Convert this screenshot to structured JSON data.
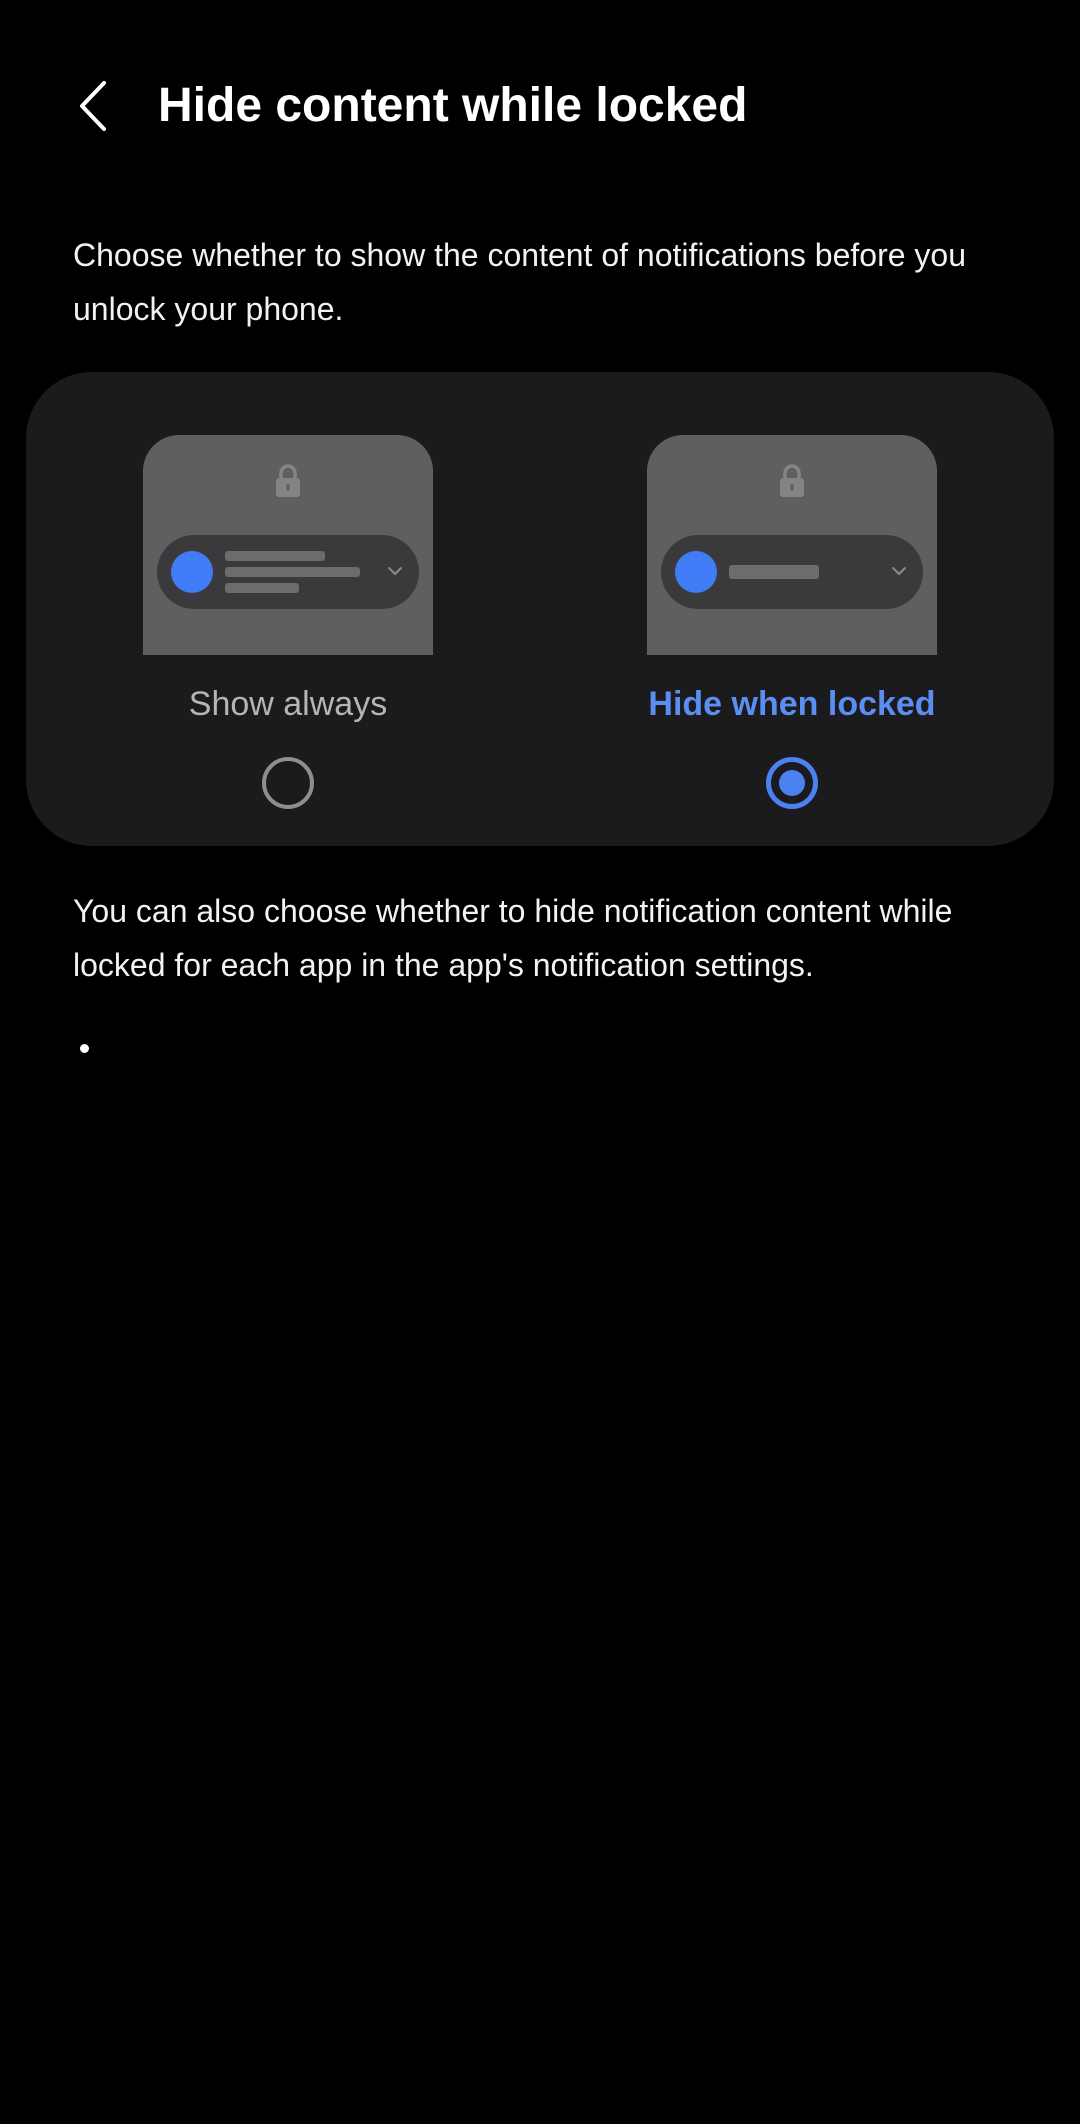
{
  "header": {
    "title": "Hide content while locked",
    "back_icon": "chevron-left-icon"
  },
  "description": "Choose whether to show the content of notifications before you unlock your phone.",
  "options": [
    {
      "label": "Show always",
      "selected": false,
      "preview": {
        "lock_icon": "lock-icon",
        "avatar_color": "#3f7cf6",
        "content_lines": 3
      }
    },
    {
      "label": "Hide when locked",
      "selected": true,
      "preview": {
        "lock_icon": "lock-icon",
        "avatar_color": "#3f7cf6",
        "content_lines": 1
      }
    }
  ],
  "note": "You can also choose whether to hide notification content while locked for each app in the app's notification settings.",
  "colors": {
    "background": "#000000",
    "card": "#1b1b1d",
    "accent": "#4a82f2",
    "accent_label": "#5a8ef2",
    "inactive_label": "#b5b5b7"
  }
}
